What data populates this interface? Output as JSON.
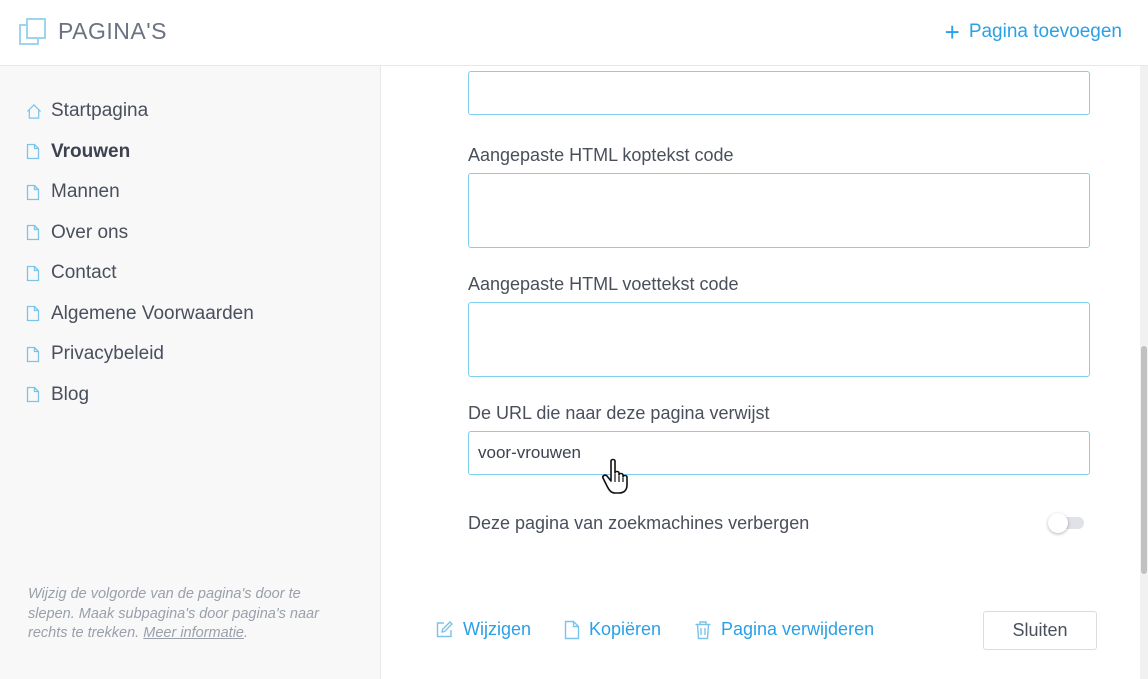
{
  "header": {
    "title": "PAGINA'S",
    "add_page_label": "Pagina toevoegen"
  },
  "sidebar": {
    "items": [
      {
        "label": "Startpagina",
        "icon": "home-icon"
      },
      {
        "label": "Vrouwen",
        "icon": "page-icon",
        "active": true
      },
      {
        "label": "Mannen",
        "icon": "page-icon"
      },
      {
        "label": "Over ons",
        "icon": "page-icon"
      },
      {
        "label": "Contact",
        "icon": "page-icon"
      },
      {
        "label": "Algemene Voorwaarden",
        "icon": "page-icon"
      },
      {
        "label": "Privacybeleid",
        "icon": "page-icon"
      },
      {
        "label": "Blog",
        "icon": "page-icon"
      }
    ],
    "hint_text": "Wijzig de volgorde van de pagina's door te slepen. Maak subpagina's door pagina's naar rechts te trekken.",
    "hint_link": "Meer informatie",
    "hint_end": "."
  },
  "form": {
    "top_field_value": "",
    "header_code_label": "Aangepaste HTML koptekst code",
    "header_code_value": "",
    "footer_code_label": "Aangepaste HTML voettekst code",
    "footer_code_value": "",
    "url_label": "De URL die naar deze pagina verwijst",
    "url_value": "voor-vrouwen",
    "hide_label": "Deze pagina van zoekmachines verbergen",
    "hide_enabled": false
  },
  "actions": {
    "edit_label": "Wijzigen",
    "copy_label": "Kopiëren",
    "delete_label": "Pagina verwijderen",
    "close_label": "Sluiten"
  },
  "colors": {
    "accent": "#2aa0e6",
    "input_border": "#7fcff0",
    "sidebar_bg": "#f8f8f9"
  }
}
